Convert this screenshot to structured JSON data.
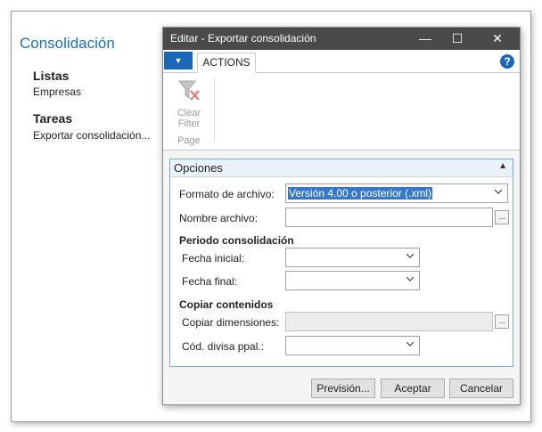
{
  "background": {
    "title": "Consolidación",
    "lists_heading": "Listas",
    "lists_item": "Empresas",
    "tasks_heading": "Tareas",
    "tasks_item": "Exportar consolidación..."
  },
  "dialog": {
    "title": "Editar - Exportar consolidación",
    "window_controls": {
      "minimize": "—",
      "maximize": "☐",
      "close": "✕"
    },
    "ribbon": {
      "menu_icon": "▼",
      "tab_actions": "ACTIONS",
      "help_icon": "?",
      "clear_filter_line1": "Clear",
      "clear_filter_line2": "Filter",
      "group_label": "Page"
    },
    "section_title": "Opciones",
    "fields": {
      "formato_label": "Formato de archivo:",
      "formato_value": "Versión 4.00 o posterior (.xml)",
      "nombre_label": "Nombre archivo:",
      "nombre_value": "",
      "periodo_heading": "Periodo consolidación",
      "fecha_inicial_label": "Fecha inicial:",
      "fecha_final_label": "Fecha final:",
      "copiar_heading": "Copiar contenidos",
      "copiar_dim_label": "Copiar dimensiones:",
      "divisa_label": "Cód. divisa ppal.:",
      "ellipsis": "..."
    },
    "buttons": {
      "preview": "Previsión...",
      "ok": "Aceptar",
      "cancel": "Cancelar"
    }
  },
  "colors": {
    "accent": "#1a66b9",
    "title_bar": "#4a4a4a",
    "selection": "#3578c8",
    "heading_blue": "#1f6fb5"
  }
}
